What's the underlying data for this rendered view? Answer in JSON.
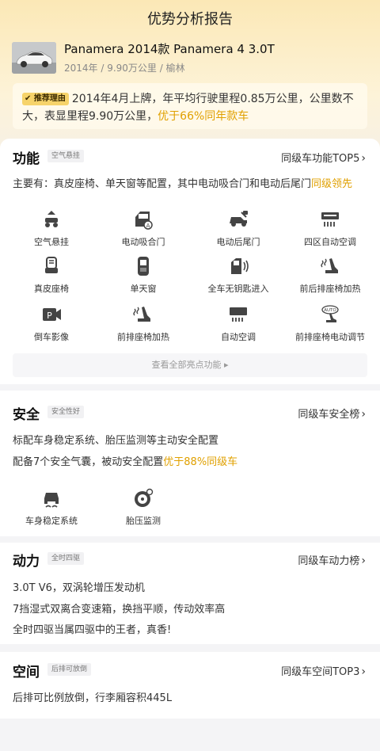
{
  "header": {
    "title": "优势分析报告"
  },
  "car": {
    "name": "Panamera 2014款 Panamera 4 3.0T",
    "meta": "2014年 / 9.90万公里 / 榆林"
  },
  "reason": {
    "tag": "推荐理由",
    "text": "2014年4月上牌，年平均行驶里程0.85万公里，公里数不大，表显里程9.90万公里，",
    "highlight": "优于66%同年款车"
  },
  "features": {
    "title": "功能",
    "badge": "空气悬挂",
    "link": "同级车功能TOP5",
    "summary": "主要有：真皮座椅、单天窗等配置，其中电动吸合门和电动后尾门",
    "summary_hl": "同级领先",
    "items": [
      {
        "label": "空气悬挂",
        "icon": "air-suspension-icon"
      },
      {
        "label": "电动吸合门",
        "icon": "soft-close-door-icon"
      },
      {
        "label": "电动后尾门",
        "icon": "power-tailgate-icon"
      },
      {
        "label": "四区自动空调",
        "icon": "four-zone-ac-icon"
      },
      {
        "label": "真皮座椅",
        "icon": "leather-seat-icon"
      },
      {
        "label": "单天窗",
        "icon": "sunroof-icon"
      },
      {
        "label": "全车无钥匙进入",
        "icon": "keyless-entry-icon"
      },
      {
        "label": "前后排座椅加热",
        "icon": "seat-heating-icon"
      },
      {
        "label": "倒车影像",
        "icon": "reverse-camera-icon"
      },
      {
        "label": "前排座椅加热",
        "icon": "front-seat-heating-icon"
      },
      {
        "label": "自动空调",
        "icon": "auto-ac-icon"
      },
      {
        "label": "前排座椅电动调节",
        "icon": "power-seat-icon"
      }
    ],
    "view_all": "查看全部亮点功能 ▸"
  },
  "safety": {
    "title": "安全",
    "badge": "安全性好",
    "link": "同级车安全榜",
    "line1": "标配车身稳定系统、胎压监测等主动安全配置",
    "line2": "配备7个安全气囊，被动安全配置",
    "line2_hl": "优于88%同级车",
    "items": [
      {
        "label": "车身稳定系统",
        "icon": "stability-control-icon"
      },
      {
        "label": "胎压监测",
        "icon": "tire-pressure-icon"
      }
    ]
  },
  "power": {
    "title": "动力",
    "badge": "全时四驱",
    "link": "同级车动力榜",
    "lines": [
      "3.0T V6，双涡轮增压发动机",
      "7挡湿式双离合变速箱，换挡平顺，传动效率高",
      "全时四驱当属四驱中的王者，真香!"
    ]
  },
  "space": {
    "title": "空间",
    "badge": "后排可放倒",
    "link": "同级车空间TOP3",
    "line": "后排可比例放倒，行李厢容积445L"
  },
  "colors": {
    "accent": "#e0a000",
    "tag": "#f6d36a",
    "header_bg": "#fbe8b6"
  }
}
